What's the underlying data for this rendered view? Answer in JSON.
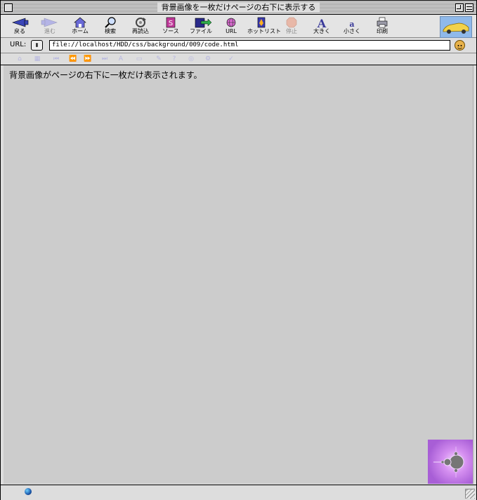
{
  "window": {
    "title": "背景画像を一枚だけページの右下に表示する"
  },
  "toolbar": {
    "buttons": [
      {
        "label": "戻る",
        "icon": "back-arrow-icon",
        "enabled": true
      },
      {
        "label": "進む",
        "icon": "forward-arrow-icon",
        "enabled": false
      },
      {
        "label": "ホーム",
        "icon": "home-icon",
        "enabled": true
      },
      {
        "label": "検索",
        "icon": "search-icon",
        "enabled": true
      },
      {
        "label": "再読込",
        "icon": "reload-icon",
        "enabled": true
      },
      {
        "label": "ソース",
        "icon": "source-icon",
        "enabled": true
      },
      {
        "label": "ファイル",
        "icon": "file-icon",
        "enabled": true
      },
      {
        "label": "URL",
        "icon": "url-globe-icon",
        "enabled": true
      },
      {
        "label": "ホットリスト",
        "icon": "hotlist-icon",
        "enabled": true
      },
      {
        "label": "停止",
        "icon": "stop-icon",
        "enabled": false
      },
      {
        "label": "大きく",
        "icon": "text-bigger-icon",
        "enabled": true
      },
      {
        "label": "小さく",
        "icon": "text-smaller-icon",
        "enabled": true
      },
      {
        "label": "印刷",
        "icon": "print-icon",
        "enabled": true
      }
    ],
    "logo_icon": "car-logo-icon"
  },
  "urlbar": {
    "label": "URL:",
    "value": "file://localhost/HDD/css/background/009/code.html"
  },
  "content": {
    "text": "背景画像がページの右下に一枚だけ表示されます。",
    "background_image_icon": "mandelbrot-fractal-image"
  },
  "colors": {
    "content_bg": "#cccccc",
    "fractal_bg": "#b070d8",
    "fractal_set": "#7a7a7a"
  }
}
